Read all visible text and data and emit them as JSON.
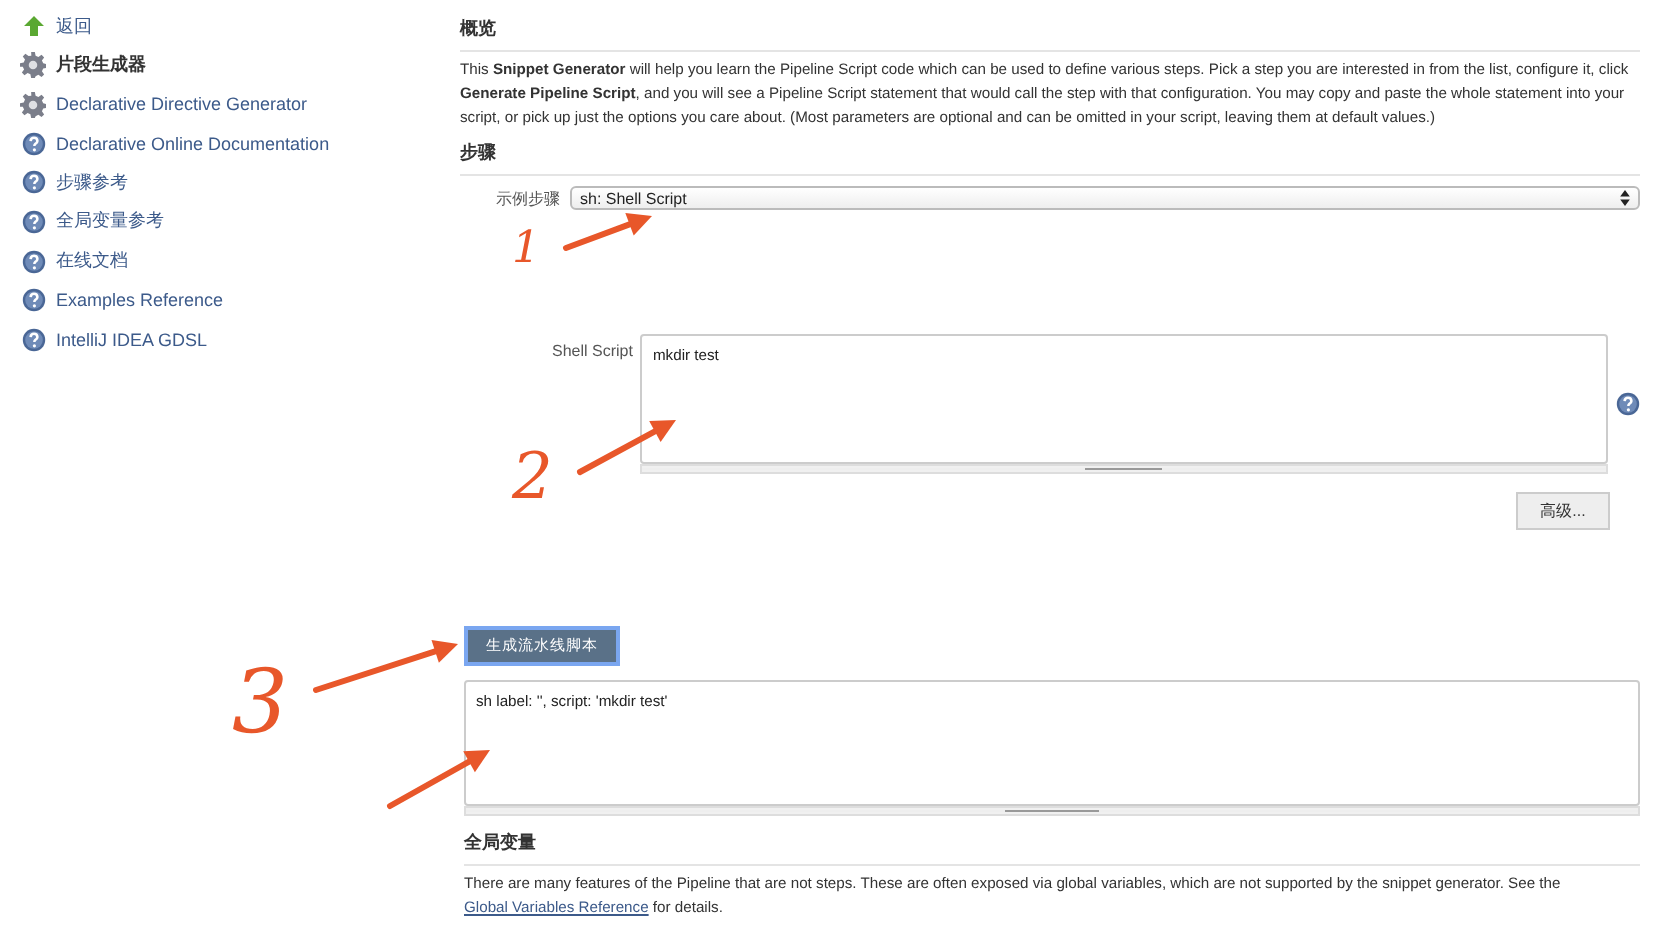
{
  "sidebar": {
    "items": [
      {
        "label": "返回",
        "kind": "back",
        "selected": false
      },
      {
        "label": "片段生成器",
        "kind": "tool",
        "selected": true
      },
      {
        "label": "Declarative Directive Generator",
        "kind": "tool",
        "selected": false
      },
      {
        "label": "Declarative Online Documentation",
        "kind": "doc",
        "selected": false
      },
      {
        "label": "步骤参考",
        "kind": "doc",
        "selected": false
      },
      {
        "label": "全局变量参考",
        "kind": "doc",
        "selected": false
      },
      {
        "label": "在线文档",
        "kind": "doc",
        "selected": false
      },
      {
        "label": "Examples Reference",
        "kind": "doc",
        "selected": false
      },
      {
        "label": "IntelliJ IDEA GDSL",
        "kind": "doc",
        "selected": false
      }
    ]
  },
  "overview": {
    "heading": "概览",
    "text": "This **Snippet Generator** will help you learn the Pipeline Script code which can be used to define various steps. Pick a step you are interested in from the list, configure it, click **Generate Pipeline Script**, and you will see a Pipeline Script statement that would call the step with that configuration. You may copy and paste the whole statement into your script, or pick up just the options you care about. (Most parameters are optional and can be omitted in your script, leaving them at default values.)"
  },
  "steps": {
    "heading": "步骤",
    "sample_label": "示例步骤",
    "sample_value": "sh: Shell Script",
    "script_label": "Shell Script",
    "script_value": "mkdir test",
    "advanced_button": "高级..."
  },
  "generate_button": "生成流水线脚本",
  "output": "sh label: '', script: 'mkdir test'",
  "globals": {
    "heading": "全局变量",
    "text_before": "There are many features of the Pipeline that are not steps. These are often exposed via global variables, which are not supported by the snippet generator. See the ",
    "link": "Global Variables Reference",
    "text_after": " for details."
  },
  "annotations": [
    {
      "label": "1"
    },
    {
      "label": "2"
    },
    {
      "label": "3"
    }
  ]
}
